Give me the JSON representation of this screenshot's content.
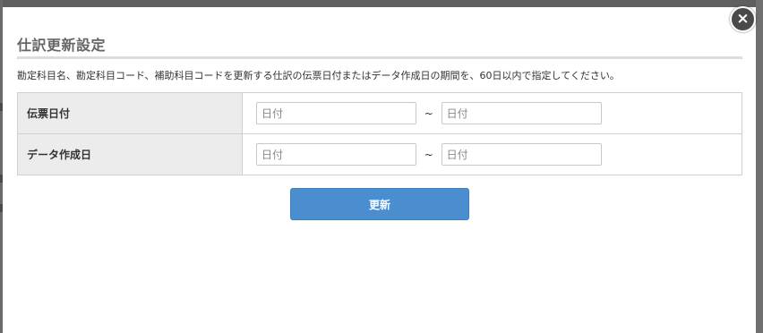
{
  "dialog": {
    "title": "仕訳更新設定",
    "description": "勘定科目名、勘定科目コード、補助科目コードを更新する仕訳の伝票日付またはデータ作成日の期間を、60日以内で指定してください。",
    "close_icon": "×",
    "rows": [
      {
        "label": "伝票日付",
        "from_placeholder": "日付",
        "separator": "~",
        "to_placeholder": "日付"
      },
      {
        "label": "データ作成日",
        "from_placeholder": "日付",
        "separator": "~",
        "to_placeholder": "日付"
      }
    ],
    "submit_label": "更新"
  }
}
